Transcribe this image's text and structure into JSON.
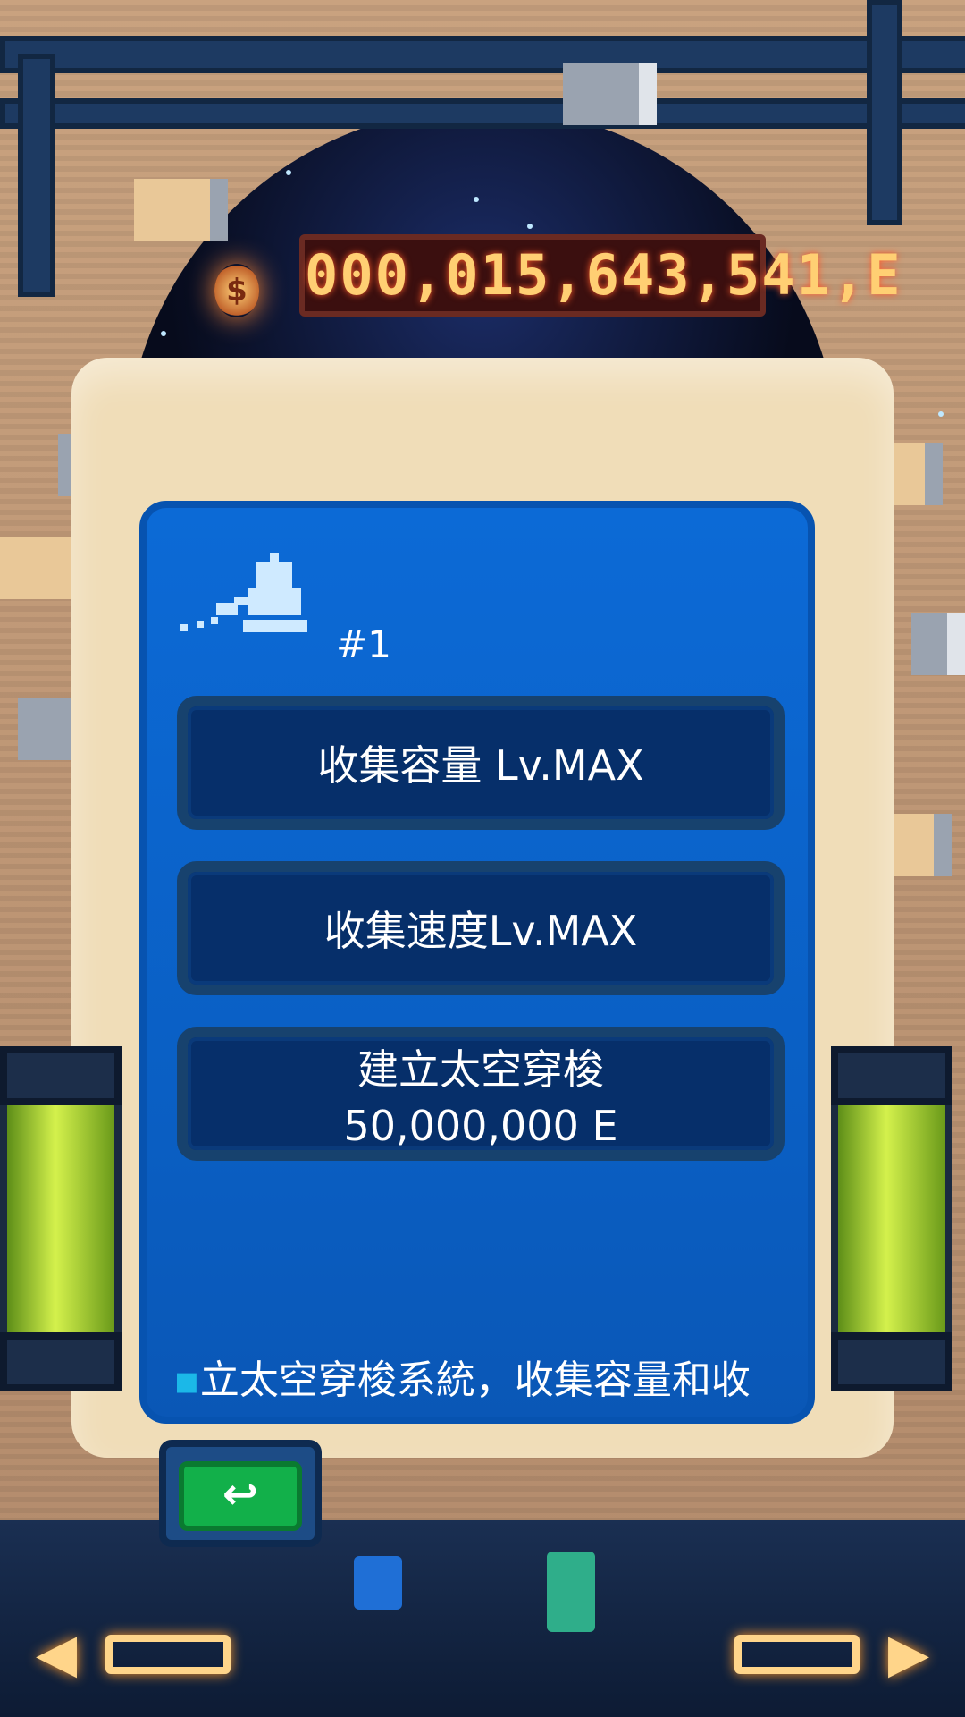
{
  "hud": {
    "energy_counter": "000,015,643,541,E",
    "currency_icon": "coin-icon"
  },
  "panel": {
    "robot_icon": "collector-robot-icon",
    "robot_index": "#1",
    "buttons": [
      {
        "label": "收集容量 Lv.MAX",
        "sub": ""
      },
      {
        "label": "收集速度Lv.MAX",
        "sub": ""
      },
      {
        "label": "建立太空穿梭",
        "sub": "50,000,000 E"
      }
    ],
    "info_text": "立太空穿梭系統，收集容量和收"
  },
  "back_button": {
    "icon": "return-arrow-icon",
    "glyph": "↩"
  },
  "nav": {
    "left_icon": "left-arrow-icon",
    "right_icon": "right-arrow-icon",
    "left_glyph": "◀",
    "right_glyph": "▶"
  },
  "colors": {
    "panel_blue": "#0c6ad6",
    "button_bg": "#062f6a",
    "counter_text": "#ffcf73",
    "back_green": "#12b04a"
  }
}
